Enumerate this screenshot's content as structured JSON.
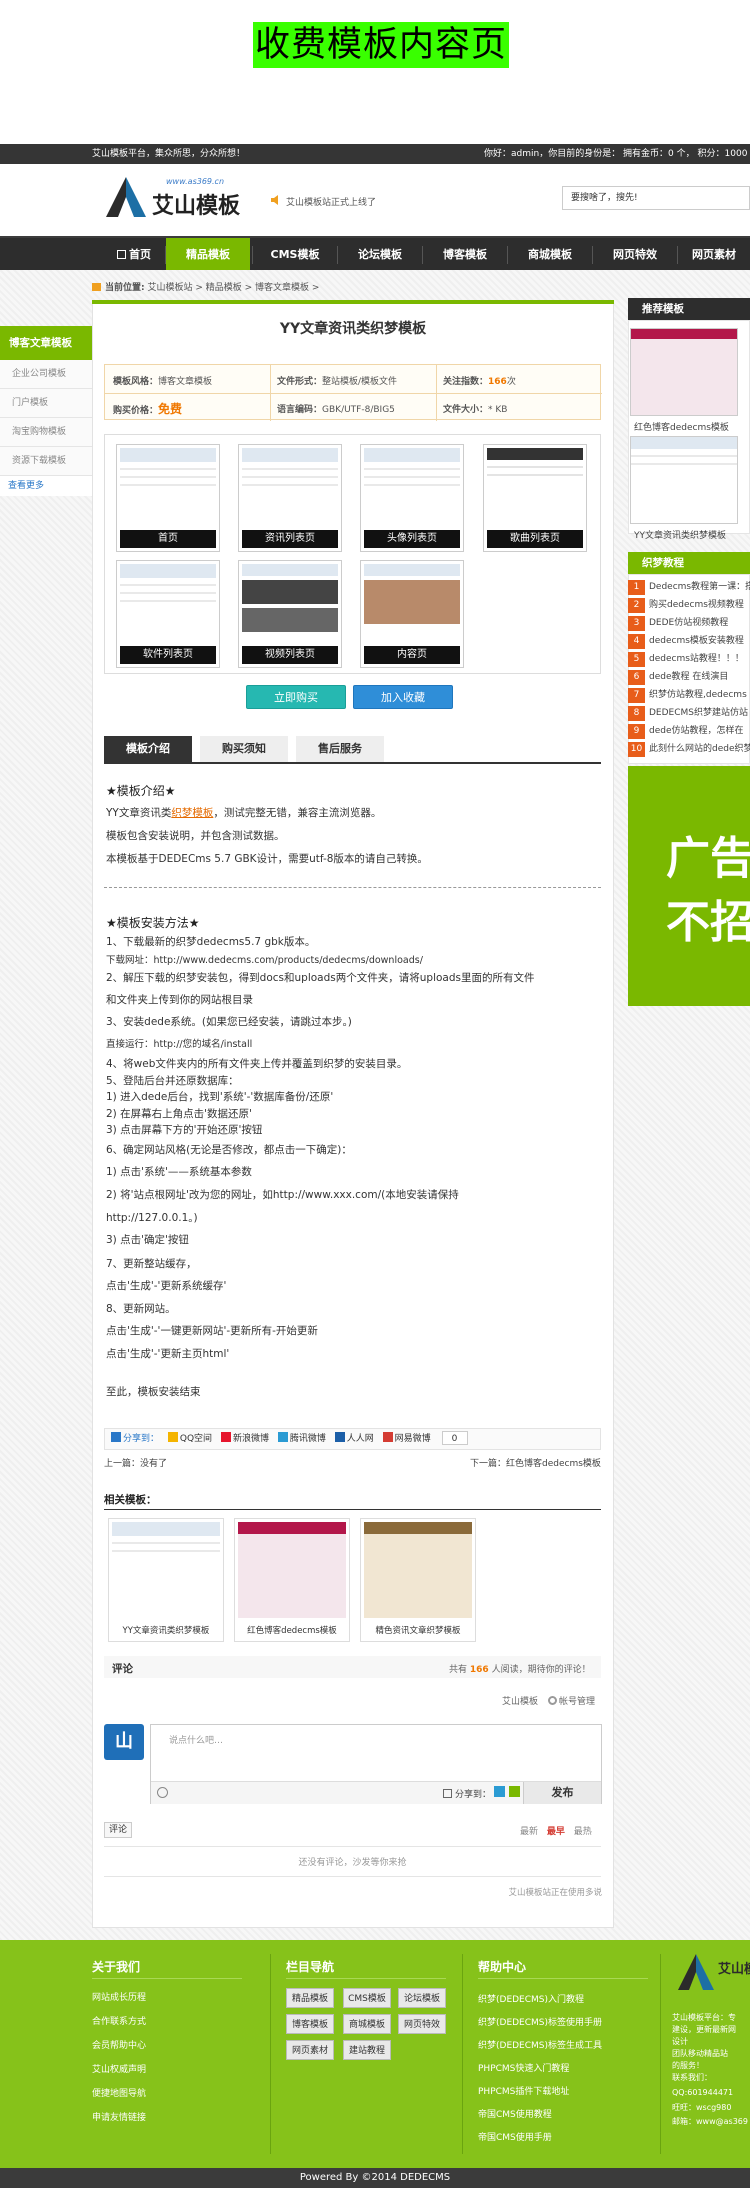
{
  "page_banner": "收费模板内容页",
  "topbar": {
    "left": "艾山模板平台，集众所思，分众所想！",
    "right": "你好：admin，你目前的身份是： 拥有金币：0 个， 积分：1000"
  },
  "header": {
    "logo_url_text": "www.as369.cn",
    "logo_text": "艾山模板",
    "notice": "艾山模板站正式上线了",
    "search_placeholder": "要搜啥了，搜先!"
  },
  "nav": [
    "首页",
    "精品模板",
    "CMS模板",
    "论坛模板",
    "博客模板",
    "商城模板",
    "网页特效",
    "网页素材"
  ],
  "breadcrumb": {
    "label": "当前位置:",
    "items": [
      "艾山模板站",
      "精品模板",
      "博客文章模板"
    ]
  },
  "left_sidebar": {
    "title": "博客文章模板",
    "items": [
      "企业公司模板",
      "门户模板",
      "淘宝购物模板",
      "资源下载模板",
      "查看更多"
    ]
  },
  "product": {
    "title": "YY文章资讯类织梦模板",
    "info": [
      {
        "label": "模板风格：",
        "value": "博客文章模板"
      },
      {
        "label": "文件形式：",
        "value": "整站模板/模板文件"
      },
      {
        "label": "关注指数：",
        "value": "166",
        "suffix": "次"
      },
      {
        "label": "购买价格：",
        "value": "免费"
      },
      {
        "label": "语言编码：",
        "value": "GBK/UTF-8/BIG5"
      },
      {
        "label": "文件大小：",
        "value": "* KB"
      }
    ],
    "thumbs": [
      "首页",
      "资讯列表页",
      "头像列表页",
      "歌曲列表页",
      "软件列表页",
      "视频列表页",
      "内容页"
    ],
    "buy_button": "立即购买",
    "fav_button": "加入收藏"
  },
  "tabs": [
    "模板介绍",
    "购买须知",
    "售后服务"
  ],
  "intro": {
    "heading": "★模板介绍★",
    "line1_pre": "YY文章资讯类",
    "line1_link": "织梦模板",
    "line1_post": "，测试完整无错，兼容主流浏览器。",
    "line2": "模板包含安装说明，并包含测试数据。",
    "line3": "本模板基于DEDECms 5.7 GBK设计，需要utf-8版本的请自己转换。"
  },
  "install": {
    "heading": "★模板安装方法★",
    "lines": [
      "1、下载最新的织梦dedecms5.7 gbk版本。",
      "下载网址：http://www.dedecms.com/products/dedecms/downloads/",
      "2、解压下载的织梦安装包，得到docs和uploads两个文件夹，请将uploads里面的所有文件",
      "和文件夹上传到你的网站根目录",
      "3、安装dede系统。(如果您已经安装，请跳过本步。)",
      "直接运行：http://您的域名/install",
      "4、将web文件夹内的所有文件夹上传并覆盖到织梦的安装目录。",
      "5、登陆后台并还原数据库：",
      "1) 进入dede后台，找到'系统'-'数据库备份/还原'",
      "2) 在屏幕右上角点击'数据还原'",
      "3) 点击屏幕下方的'开始还原'按钮",
      "6、确定网站风格(无论是否修改，都点击一下确定)：",
      "1) 点击'系统'——系统基本参数",
      "2) 将'站点根网址'改为您的网址，如http://www.xxx.com/(本地安装请保持",
      "http://127.0.0.1。)",
      "3) 点击'确定'按钮",
      "7、更新整站缓存，",
      "点击'生成'-'更新系统缓存'",
      "8、更新网站。",
      "点击'生成'-'一键更新网站'-更新所有-开始更新",
      "点击'生成'-'更新主页html'",
      "至此，模板安装结束"
    ]
  },
  "share": {
    "label": "分享到：",
    "items": [
      "QQ空间",
      "新浪微博",
      "腾讯微博",
      "人人网",
      "网易微博"
    ],
    "count": "0"
  },
  "prevnext": {
    "prev": "上一篇：没有了",
    "next": "下一篇：红色博客dedecms模板"
  },
  "related": {
    "title": "相关模板：",
    "items": [
      "YY文章资讯类织梦模板",
      "红色博客dedecms模板",
      "精色资讯文章织梦模板"
    ]
  },
  "comments": {
    "title": "评论",
    "stat_pre": "共有",
    "stat_num": "166",
    "stat_post": "人阅读，期待你的评论！",
    "site_name": "艾山模板",
    "account_label": "帐号管理",
    "placeholder": "说点什么吧…",
    "share_label": "分享到：",
    "submit": "发布",
    "comment_tag": "评论",
    "sort": [
      "最新",
      "最早",
      "最热"
    ],
    "empty": "还没有评论，沙发等你来抢",
    "powered": "艾山模板站正在使用多说"
  },
  "right_sidebar": {
    "recommend_title": "推荐模板",
    "recommend": [
      "红色博客dedecms模板",
      "YY文章资讯类织梦模板"
    ],
    "tutorial_title": "织梦教程",
    "tutorials": [
      "Dedecms教程第一课：搭",
      "购买dedecms视频教程",
      "DEDE仿站视频教程",
      "dedecms模板安装教程",
      "dedecms站教程！！！",
      "dede教程 在线演目",
      "织梦仿站教程,dedecms",
      "DEDECMS织梦建站仿站",
      "dede仿站教程，怎样在",
      "此刻什么网站的dede织梦"
    ],
    "ad_text": [
      "广告",
      "不招"
    ]
  },
  "footer": {
    "about_title": "关于我们",
    "about": [
      "网站成长历程",
      "合作联系方式",
      "会员帮助中心",
      "艾山权威声明",
      "便捷地图导航",
      "申请友情链接"
    ],
    "nav_title": "栏目导航",
    "nav_buttons": [
      "精品模板",
      "CMS模板",
      "论坛模板",
      "博客模板",
      "商城模板",
      "网页特效",
      "网页素材",
      "建站教程"
    ],
    "help_title": "帮助中心",
    "help": [
      "织梦(DEDECMS)入门教程",
      "织梦(DEDECMS)标签使用手册",
      "织梦(DEDECMS)标签生成工具",
      "PHPCMS快速入门教程",
      "PHPCMS插件下载地址",
      "帝国CMS使用教程",
      "帝国CMS使用手册"
    ],
    "brand_lines": [
      "艾山模板平台：专",
      "建设，更新最新网",
      "设计",
      "团队移动精品站",
      "的服务！",
      "联系我们：",
      "QQ:601944471",
      "旺旺：wscg980",
      "邮箱：www@as369"
    ],
    "bottom": "Powered By ©2014 DEDECMS"
  }
}
